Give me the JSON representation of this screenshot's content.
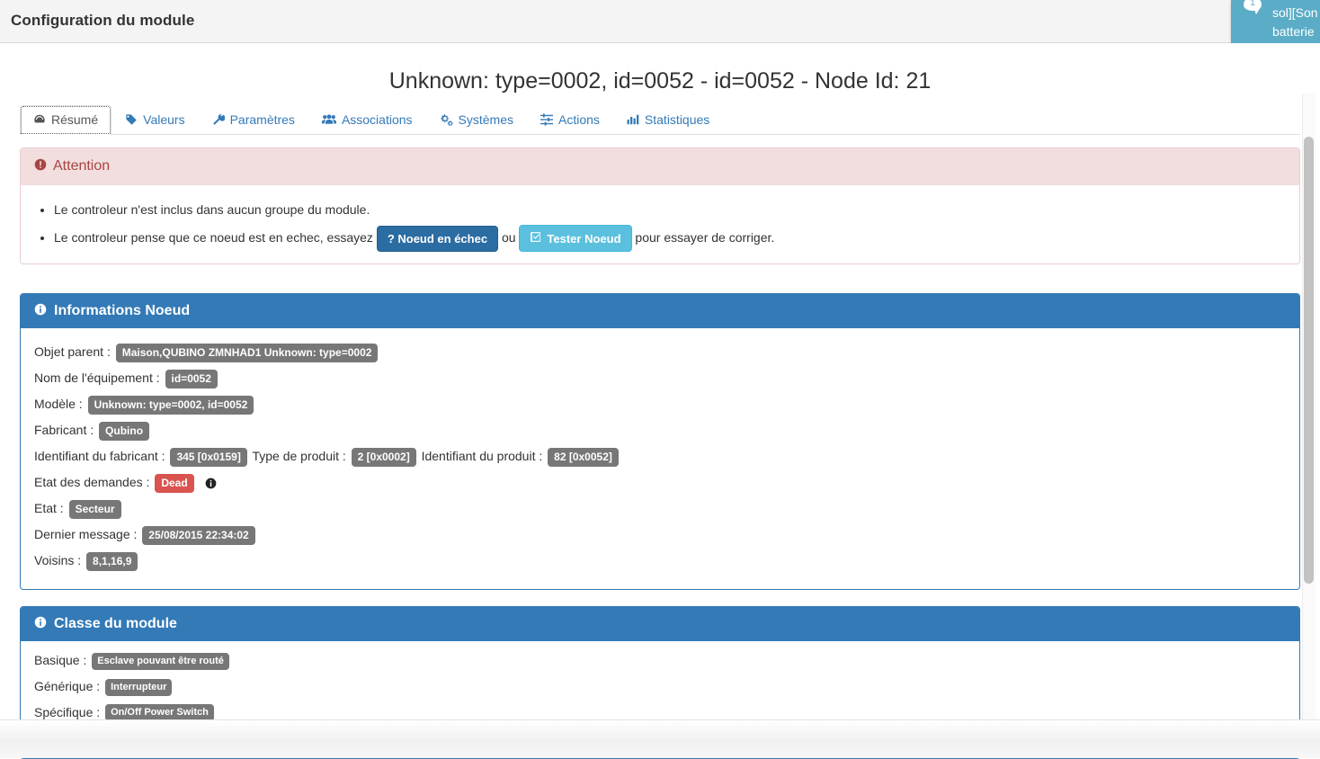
{
  "window": {
    "title": "Configuration du module"
  },
  "toast": {
    "count": "1",
    "line1": "sol][Son",
    "line2": "batterie",
    "icon": "comment-bubble-icon",
    "bg": "#5bacc6"
  },
  "page": {
    "title": "Unknown: type=0002, id=0052 - id=0052 - Node Id: 21"
  },
  "tabs": [
    {
      "label": "Résumé",
      "icon": "dashboard-icon",
      "active": true
    },
    {
      "label": "Valeurs",
      "icon": "tag-icon",
      "active": false
    },
    {
      "label": "Paramètres",
      "icon": "wrench-icon",
      "active": false
    },
    {
      "label": "Associations",
      "icon": "users-icon",
      "active": false
    },
    {
      "label": "Systèmes",
      "icon": "gears-icon",
      "active": false
    },
    {
      "label": "Actions",
      "icon": "sliders-icon",
      "active": false
    },
    {
      "label": "Statistiques",
      "icon": "bar-chart-icon",
      "active": false
    }
  ],
  "alert": {
    "icon": "exclamation-circle-icon",
    "title": "Attention",
    "item1": "Le controleur n'est inclus dans aucun groupe du module.",
    "item2_prefix": "Le controleur pense que ce noeud est en echec, essayez",
    "btn_failed": "? Noeud en échec",
    "between": "ou",
    "btn_test": "Tester Noeud",
    "btn_test_icon": "check-square-icon",
    "item2_suffix": "pour essayer de corriger.",
    "bg": "#f2dede",
    "color": "#a94442"
  },
  "node_info": {
    "icon": "info-circle-icon",
    "title": "Informations Noeud",
    "labels": {
      "parent": "Objet parent :",
      "name": "Nom de l'équipement :",
      "model": "Modèle :",
      "manufacturer": "Fabricant :",
      "manufacturer_id": "Identifiant du fabricant :",
      "product_type": "Type de produit :",
      "product_id": "Identifiant du produit :",
      "query_state": "Etat des demandes :",
      "state": "Etat :",
      "last_message": "Dernier message :",
      "neighbours": "Voisins :"
    },
    "values": {
      "parent": "Maison,QUBINO ZMNHAD1 Unknown: type=0002",
      "name": "id=0052",
      "model": "Unknown: type=0002, id=0052",
      "manufacturer": "Qubino",
      "manufacturer_id": "345 [0x0159]",
      "product_type": "2 [0x0002]",
      "product_id": "82 [0x0052]",
      "query_state": "Dead",
      "state": "Secteur",
      "last_message": "25/08/2015 22:34:02",
      "neighbours": "8,1,16,9"
    },
    "query_state_color": "#d9534f",
    "query_state_info_icon": "info-circle-icon"
  },
  "module_class": {
    "icon": "info-circle-icon",
    "title": "Classe du module",
    "labels": {
      "basic": "Basique :",
      "generic": "Générique :",
      "specific": "Spécifique :"
    },
    "values": {
      "basic": "Esclave pouvant être routé",
      "generic": "Interrupteur",
      "specific": "On/Off Power Switch"
    }
  },
  "scrollbar": {
    "name": "vertical-scrollbar"
  }
}
